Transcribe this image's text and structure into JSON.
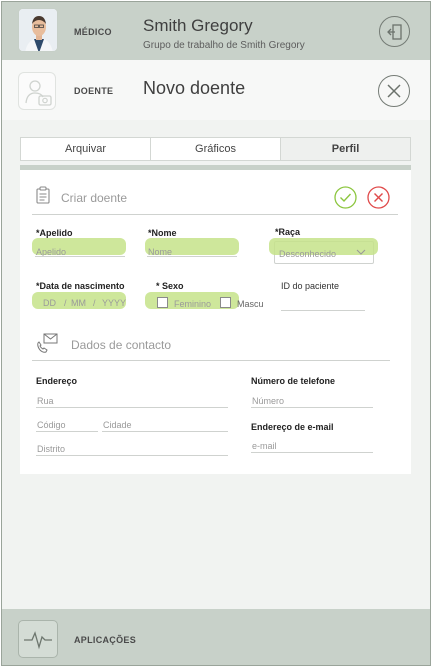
{
  "doctor": {
    "role_label": "MÉDICO",
    "name": "Smith Gregory",
    "group": "Grupo de trabalho de Smith Gregory"
  },
  "patient": {
    "role_label": "DOENTE",
    "title": "Novo doente"
  },
  "tabs": [
    {
      "label": "Arquivar",
      "active": false
    },
    {
      "label": "Gráficos",
      "active": false
    },
    {
      "label": "Perfil",
      "active": true
    }
  ],
  "form": {
    "header": "Criar doente",
    "surname": {
      "label": "*Apelido",
      "placeholder": "Apelido"
    },
    "firstname": {
      "label": "*Nome",
      "placeholder": "Nome"
    },
    "race": {
      "label": "*Raça",
      "value": "Desconhecido"
    },
    "dob": {
      "label": "*Data de nascimento",
      "dd": "DD",
      "mm": "MM",
      "yyyy": "YYYY",
      "sep": "/"
    },
    "sex": {
      "label": "* Sexo",
      "female": "Feminino",
      "male": "Mascu"
    },
    "patient_id": {
      "label": "ID do paciente"
    },
    "contact": {
      "header": "Dados de contacto",
      "address_label": "Endereço",
      "street": "Rua",
      "postcode": "Código",
      "city": "Cidade",
      "district": "Distrito",
      "phone_label": "Número de telefone",
      "phone_ph": "Número",
      "email_label": "Endereço de e-mail",
      "email_ph": "e-mail"
    }
  },
  "apps": {
    "label": "APLICAÇÕES"
  },
  "colors": {
    "header_bg": "#c8d1c9",
    "highlight": "#c6e38a",
    "confirm": "#8cc63f",
    "cancel": "#e04a4a"
  },
  "icons": {
    "logout": "logout-door-icon",
    "close": "close-circle-icon",
    "clipboard": "clipboard-icon",
    "confirm": "check-circle-icon",
    "cancel": "x-circle-icon",
    "contact": "phone-mail-icon",
    "apps": "heartbeat-icon"
  }
}
